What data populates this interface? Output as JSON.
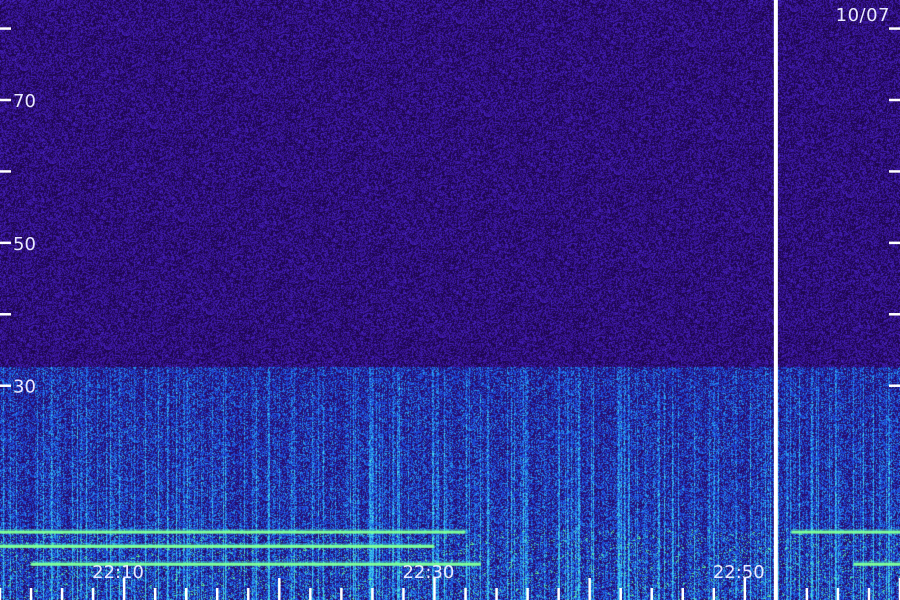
{
  "chart_data": {
    "type": "heatmap",
    "title": "",
    "date_label": "10/07",
    "x_tick_labels": [
      "22:10",
      "22:30",
      "22:50"
    ],
    "x_range": [
      "22:02",
      "23:00"
    ],
    "y_range": [
      0,
      84
    ],
    "y_labeled_ticks": [
      30,
      50,
      70
    ],
    "y_major_ticks": [
      30,
      40,
      50,
      60,
      70,
      80
    ],
    "marker_time": "22:52",
    "grid": false,
    "colors": {
      "background": "#22085a",
      "noise": "#3a1596",
      "low_band": "#1e5fd6",
      "streak": "#3fd2f0",
      "line": "#7fff9a",
      "text": "#e9e9ff"
    },
    "features": [
      {
        "name": "noise floor",
        "y_min": 0,
        "y_max": 84
      },
      {
        "name": "enhanced band",
        "y_min": 0,
        "y_max": 31
      },
      {
        "name": "horizontal line",
        "y": 9.5,
        "x_start": "22:02",
        "x_end": "22:32"
      },
      {
        "name": "horizontal line",
        "y": 7.5,
        "x_start": "22:02",
        "x_end": "22:30"
      },
      {
        "name": "horizontal line",
        "y": 5,
        "x_start": "22:04",
        "x_end": "22:33"
      },
      {
        "name": "horizontal line",
        "y": 9.5,
        "x_start": "22:53",
        "x_end": "23:00"
      },
      {
        "name": "horizontal line",
        "y": 5,
        "x_start": "22:57",
        "x_end": "23:00"
      }
    ]
  }
}
